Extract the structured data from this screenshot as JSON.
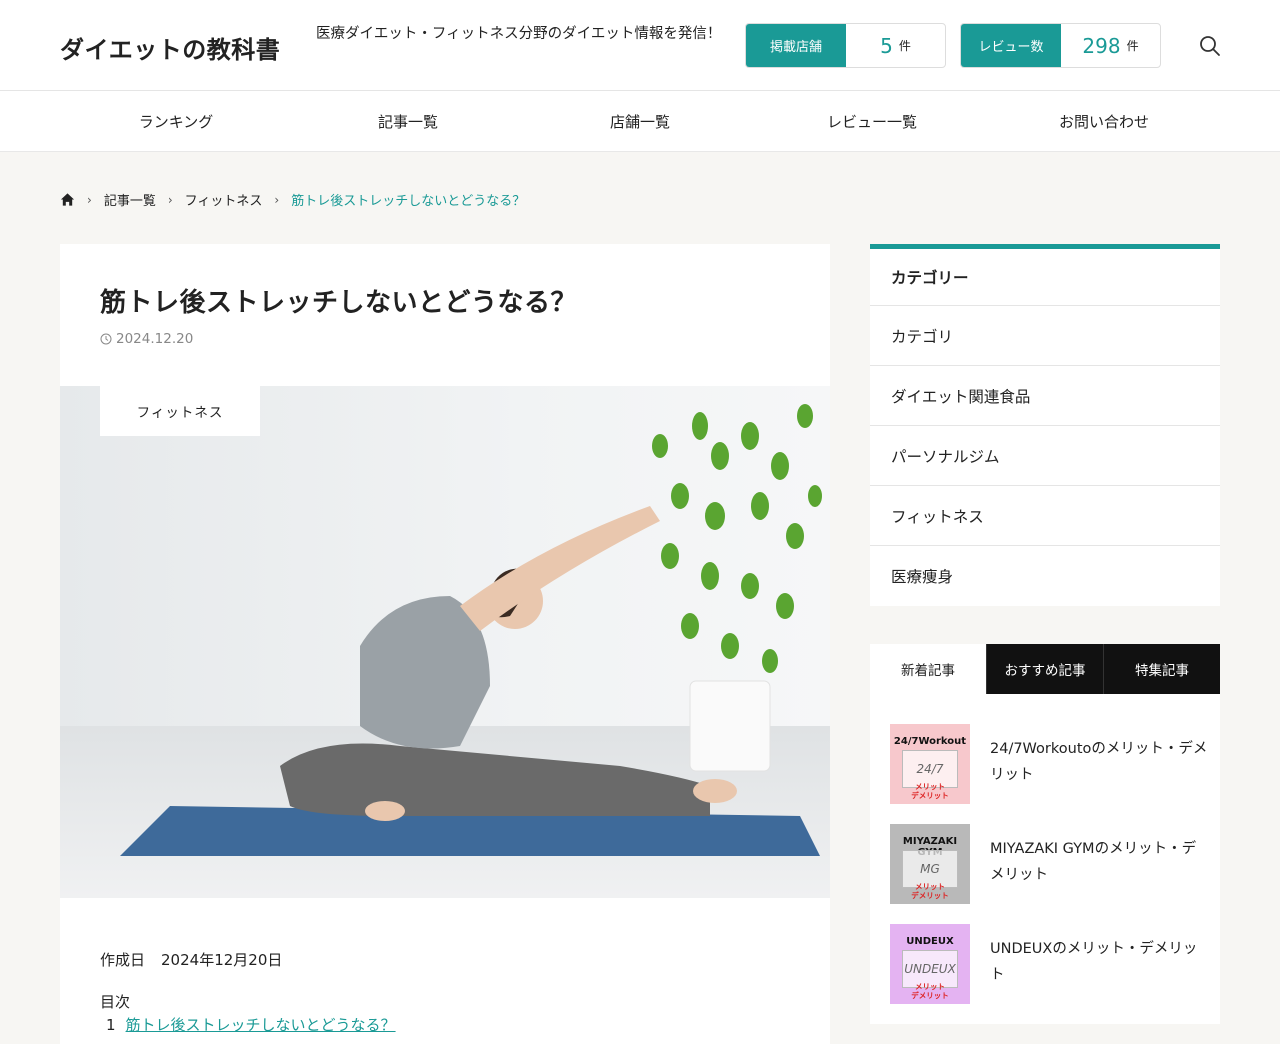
{
  "header": {
    "logo": "ダイエットの教科書",
    "tagline": "医療ダイエット・フィットネス分野のダイエット情報を発信！",
    "stats": [
      {
        "label": "掲載店舗",
        "value": "5",
        "unit": "件"
      },
      {
        "label": "レビュー数",
        "value": "298",
        "unit": "件"
      }
    ],
    "accent": "#1a9a96"
  },
  "nav": [
    "ランキング",
    "記事一覧",
    "店舗一覧",
    "レビュー一覧",
    "お問い合わせ"
  ],
  "breadcrumb": {
    "items": [
      "記事一覧",
      "フィットネス"
    ],
    "current": "筋トレ後ストレッチしないとどうなる？"
  },
  "article": {
    "title": "筋トレ後ストレッチしないとどうなる？",
    "date": "2024.12.20",
    "category": "フィットネス",
    "created_label": "作成日",
    "created_value": "2024年12月20日",
    "toc_title": "目次",
    "toc_first_num": "1",
    "toc_first": "筋トレ後ストレッチしないとどうなる？"
  },
  "sidebar": {
    "category_title": "カテゴリー",
    "categories": [
      "カテゴリ",
      "ダイエット関連食品",
      "パーソナルジム",
      "フィットネス",
      "医療痩身"
    ],
    "tabs": [
      "新着記事",
      "おすすめ記事",
      "特集記事"
    ],
    "news": [
      {
        "title": "24/7Workoutoのメリット・デメリット",
        "thumb_label": "24/7Workout",
        "thumb_mark": "24/7",
        "thumb_sub": "メリット\nデメリット",
        "color": "#f7c8cc"
      },
      {
        "title": "MIYAZAKI GYMのメリット・デメリット",
        "thumb_label": "MIYAZAKI GYM",
        "thumb_mark": "MG",
        "thumb_sub": "メリット\nデメリット",
        "color": "#b9b9b9"
      },
      {
        "title": "UNDEUXのメリット・デメリット",
        "thumb_label": "UNDEUX",
        "thumb_mark": "UNDEUX",
        "thumb_sub": "メリット\nデメリット",
        "color": "#e4b3f2"
      }
    ]
  }
}
